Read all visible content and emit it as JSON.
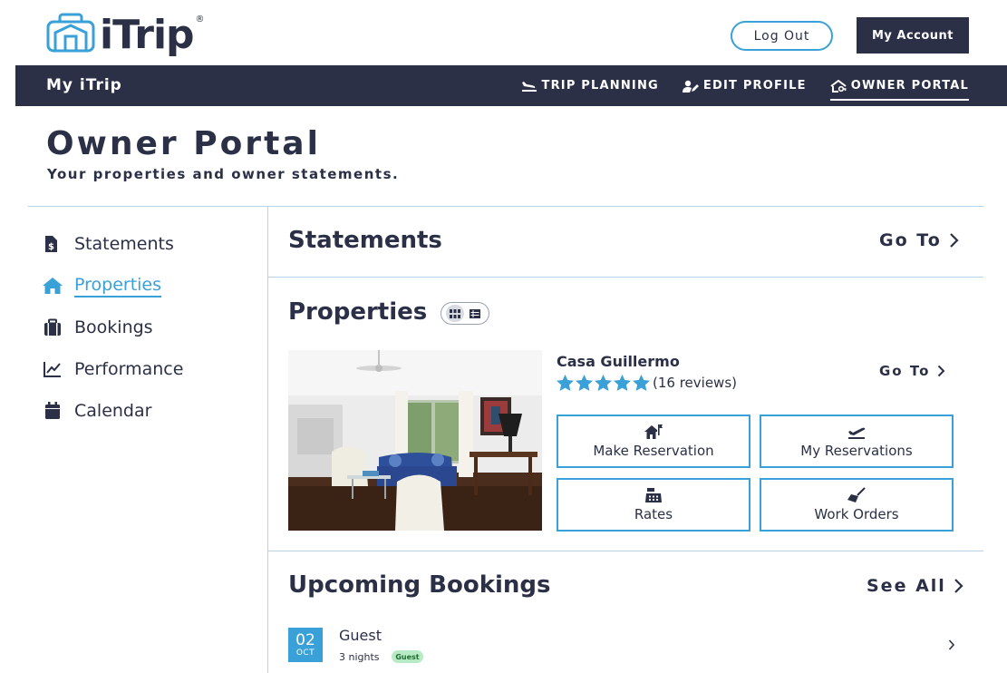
{
  "header": {
    "brand": "iTrip",
    "brand_mark": "®",
    "logout_label": "Log Out",
    "account_label": "My Account"
  },
  "nav": {
    "brand": "My iTrip",
    "items": [
      {
        "label": "TRIP PLANNING",
        "icon": "plane-landing-icon"
      },
      {
        "label": "EDIT PROFILE",
        "icon": "user-edit-icon"
      },
      {
        "label": "OWNER PORTAL",
        "icon": "house-key-icon",
        "active": true
      }
    ]
  },
  "page": {
    "title": "Owner Portal",
    "subtitle": "Your properties and owner statements."
  },
  "sidebar": {
    "items": [
      {
        "label": "Statements",
        "icon": "file-dollar-icon"
      },
      {
        "label": "Properties",
        "icon": "home-icon",
        "active": true
      },
      {
        "label": "Bookings",
        "icon": "suitcase-icon"
      },
      {
        "label": "Performance",
        "icon": "chart-line-icon"
      },
      {
        "label": "Calendar",
        "icon": "calendar-icon"
      }
    ]
  },
  "statements": {
    "title": "Statements",
    "goto_label": "Go To"
  },
  "properties": {
    "title": "Properties",
    "card": {
      "name": "Casa Guillermo",
      "rating": 5,
      "reviews": "(16 reviews)",
      "goto_label": "Go To",
      "actions": [
        {
          "label": "Make Reservation",
          "icon": "house-flag-icon"
        },
        {
          "label": "My Reservations",
          "icon": "plane-departure-icon"
        },
        {
          "label": "Rates",
          "icon": "cash-register-icon"
        },
        {
          "label": "Work Orders",
          "icon": "broom-icon"
        }
      ]
    }
  },
  "bookings": {
    "title": "Upcoming Bookings",
    "see_all_label": "See All",
    "items": [
      {
        "day": "02",
        "month": "OCT",
        "guest": "Guest",
        "nights": "3 nights",
        "badge": "Guest"
      }
    ]
  },
  "colors": {
    "navy": "#2b3047",
    "accent": "#3aa0d8",
    "divider": "#b8d3e6",
    "badge_bg": "#b7ebc4"
  }
}
